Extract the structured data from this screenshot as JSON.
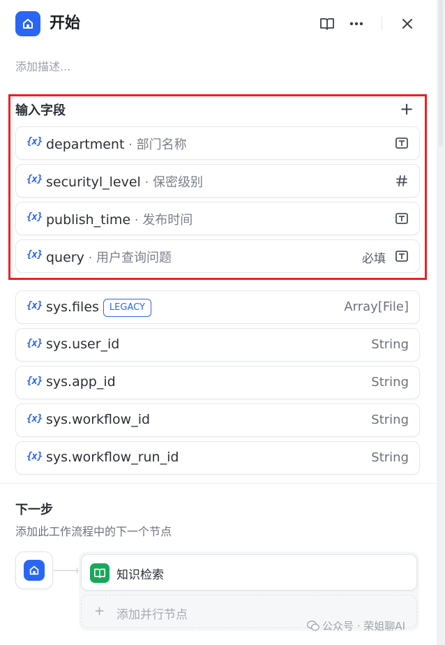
{
  "header": {
    "title": "开始",
    "description_placeholder": "添加描述..."
  },
  "input_section": {
    "title": "输入字段",
    "fields": [
      {
        "name": "department",
        "desc": " · 部门名称",
        "type_icon": "text-icon",
        "required": ""
      },
      {
        "name": "securityl_level",
        "desc": " · 保密级别",
        "type_icon": "number-icon",
        "required": ""
      },
      {
        "name": "publish_time",
        "desc": " · 发布时间",
        "type_icon": "text-icon",
        "required": ""
      },
      {
        "name": "query",
        "desc": " · 用户查询问题",
        "type_icon": "text-icon",
        "required": "必填"
      }
    ]
  },
  "system_vars": [
    {
      "name": "sys.files",
      "badge": "LEGACY",
      "type": "Array[File]"
    },
    {
      "name": "sys.user_id",
      "badge": "",
      "type": "String"
    },
    {
      "name": "sys.app_id",
      "badge": "",
      "type": "String"
    },
    {
      "name": "sys.workflow_id",
      "badge": "",
      "type": "String"
    },
    {
      "name": "sys.workflow_run_id",
      "badge": "",
      "type": "String"
    }
  ],
  "next_step": {
    "title": "下一步",
    "description": "添加此工作流程中的下一个节点",
    "node_label": "知识检索",
    "add_parallel": "添加并行节点"
  },
  "var_icon_text": "{x}",
  "watermark": "公众号 · 荣姐聊AI",
  "colors": {
    "accent": "#2a66f6",
    "highlight": "#f01e1e",
    "knowledge": "#18a85a"
  }
}
